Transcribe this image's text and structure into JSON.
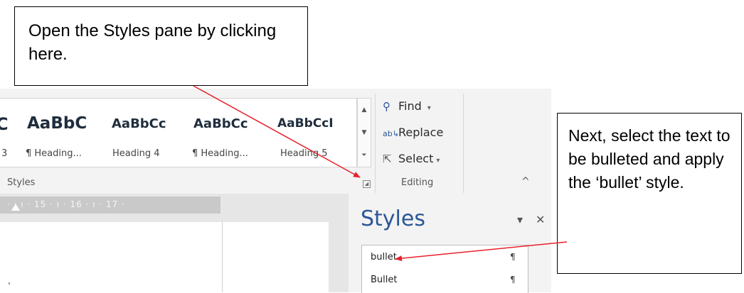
{
  "callouts": {
    "open_pane": "Open the Styles pane by clicking here.",
    "select_text": "Next, select the text to be bulleted and apply the ‘bullet’ style."
  },
  "ribbon": {
    "style_gallery": [
      {
        "sample": "C",
        "name": "3"
      },
      {
        "sample": "AaBbC",
        "name": "¶ Heading..."
      },
      {
        "sample": "AaBbCc",
        "name": "Heading 4"
      },
      {
        "sample": "AaBbCc",
        "name": "¶ Heading..."
      },
      {
        "sample": "AaBbCcI",
        "name": "Heading 5"
      }
    ],
    "styles_group_label": "Styles",
    "editing": {
      "find": "Find",
      "replace": "Replace",
      "select": "Select",
      "group_label": "Editing"
    }
  },
  "ruler": {
    "text": "·  ·  ı  · 15 ·  ı  · 16 ·  ı  · 17 ·"
  },
  "styles_pane": {
    "title": "Styles",
    "items": [
      {
        "name": "bullet",
        "mark": "¶"
      },
      {
        "name": "Bullet",
        "mark": "¶"
      }
    ]
  },
  "colors": {
    "accent": "#2b5797",
    "arrow": "#e8202a"
  }
}
